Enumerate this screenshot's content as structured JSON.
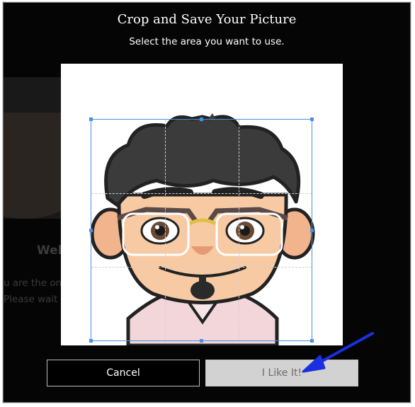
{
  "dialog": {
    "title": "Crop and Save Your Picture",
    "subtitle": "Select the area you want to use."
  },
  "background": {
    "welcome_text": "Wel",
    "line1": "u are the onl",
    "line2": "Please wait w"
  },
  "buttons": {
    "cancel_label": "Cancel",
    "like_label": "I Like It!"
  },
  "colors": {
    "overlay": "#050505",
    "crop_border": "#4a90e2",
    "annotation_arrow": "#1a2fe0"
  }
}
